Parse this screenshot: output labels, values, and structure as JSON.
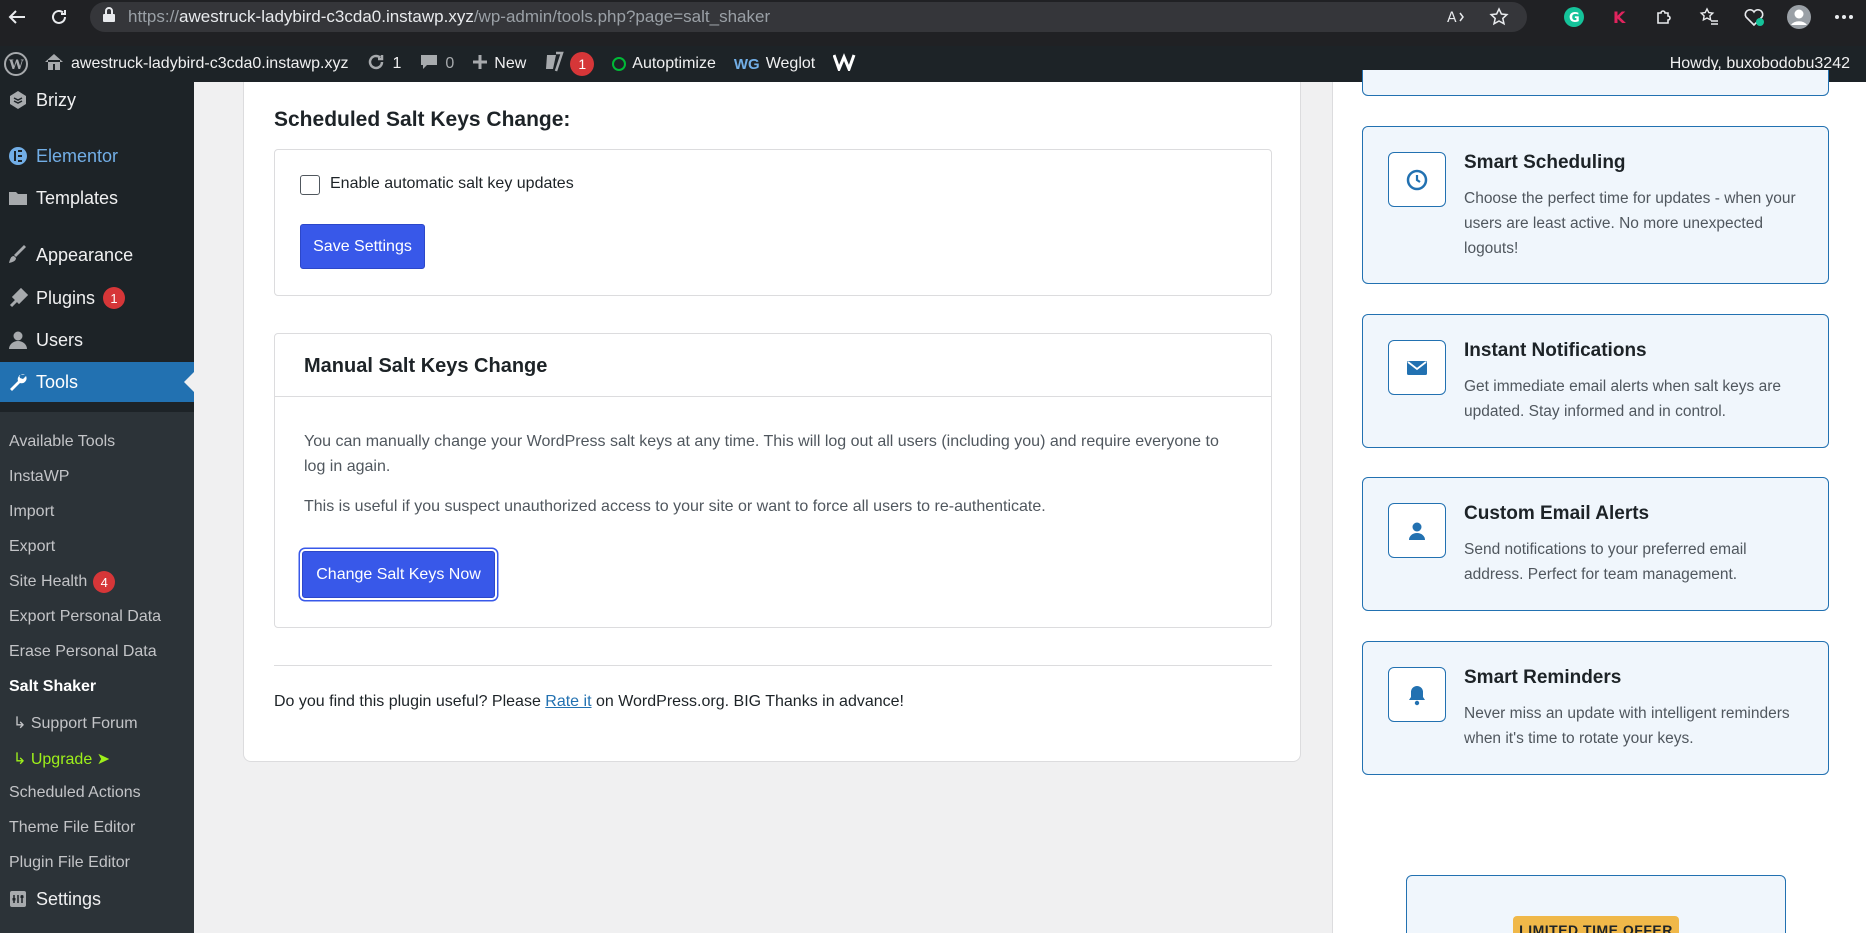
{
  "browser": {
    "url_prefix": "https://",
    "url_host": "awestruck-ladybird-c3cda0.instawp.xyz",
    "url_path": "/wp-admin/tools.php?page=salt_shaker"
  },
  "adminbar": {
    "site_name": "awestruck-ladybird-c3cda0.instawp.xyz",
    "updates_count": "1",
    "comments_count": "0",
    "new_label": "New",
    "yoast_count": "1",
    "autoptimize_label": "Autoptimize",
    "weglot_label": "Weglot",
    "howdy": "Howdy, buxobodobu3242"
  },
  "sidebar": {
    "items": [
      {
        "label": "Brizy",
        "icon": "brizy-icon"
      },
      {
        "label": "Elementor",
        "icon": "elementor-icon"
      },
      {
        "label": "Templates",
        "icon": "folder-icon"
      },
      {
        "label": "Appearance",
        "icon": "brush-icon"
      },
      {
        "label": "Plugins",
        "icon": "plugin-icon",
        "badge": "1"
      },
      {
        "label": "Users",
        "icon": "user-icon"
      },
      {
        "label": "Tools",
        "icon": "wrench-icon"
      },
      {
        "label": "Settings",
        "icon": "settings-icon"
      }
    ],
    "submenu": [
      {
        "label": "Available Tools"
      },
      {
        "label": "InstaWP"
      },
      {
        "label": "Import"
      },
      {
        "label": "Export"
      },
      {
        "label": "Site Health",
        "badge": "4"
      },
      {
        "label": "Export Personal Data"
      },
      {
        "label": "Erase Personal Data"
      },
      {
        "label": "Salt Shaker"
      },
      {
        "label": "↳ Support Forum"
      },
      {
        "label": "↳ Upgrade ➤"
      },
      {
        "label": "Scheduled Actions"
      },
      {
        "label": "Theme File Editor"
      },
      {
        "label": "Plugin File Editor"
      }
    ]
  },
  "main": {
    "scheduled_title": "Scheduled Salt Keys Change:",
    "checkbox_label": "Enable automatic salt key updates",
    "checkbox_checked": false,
    "save_label": "Save Settings",
    "manual_title": "Manual Salt Keys Change",
    "manual_p1": "You can manually change your WordPress salt keys at any time. This will log out all users (including you) and require everyone to log in again.",
    "manual_p2": "This is useful if you suspect unauthorized access to your site or want to force all users to re-authenticate.",
    "change_label": "Change Salt Keys Now",
    "footer_before": "Do you find this plugin useful? Please ",
    "footer_link": "Rate it",
    "footer_after": " on WordPress.org. BIG Thanks in advance!"
  },
  "features": [
    {
      "title": "Smart Scheduling",
      "desc": "Choose the perfect time for updates - when your users are least active. No more unexpected logouts!",
      "icon": "clock-icon"
    },
    {
      "title": "Instant Notifications",
      "desc": "Get immediate email alerts when salt keys are updated. Stay informed and in control.",
      "icon": "envelope-icon"
    },
    {
      "title": "Custom Email Alerts",
      "desc": "Send notifications to your preferred email address. Perfect for team management.",
      "icon": "person-icon"
    },
    {
      "title": "Smart Reminders",
      "desc": "Never miss an update with intelligent reminders when it's time to rotate your keys.",
      "icon": "bell-icon"
    }
  ],
  "offer": {
    "badge": "LIMITED TIME OFFER"
  },
  "colors": {
    "accent": "#3858e9",
    "wp_blue": "#2271b1",
    "admin_dark": "#1d2327"
  }
}
